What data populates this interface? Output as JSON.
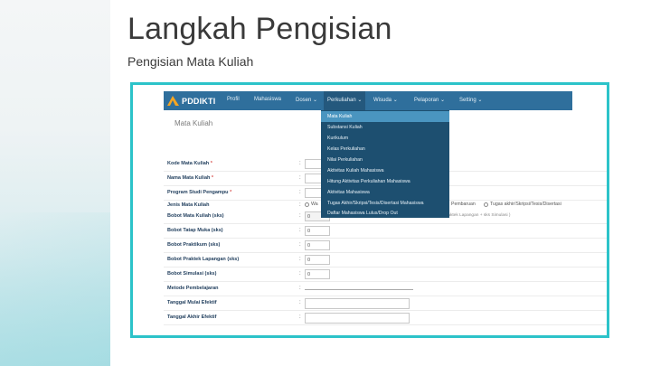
{
  "slide": {
    "title": "Langkah Pengisian",
    "subtitle": "Pengisian Mata Kuliah"
  },
  "app": {
    "brand": "PDDIKTI",
    "nav": [
      "Profil",
      "Mahasiswa",
      "Dosen",
      "Perkuliahan",
      "Wisuda",
      "Pelaporan",
      "Setting"
    ],
    "active_nav": "Perkuliahan"
  },
  "dropdown": {
    "items": [
      "Mata Kuliah",
      "Substansi Kuliah",
      "Kurikulum",
      "Kelas Perkuliahan",
      "Nilai Perkuliahan",
      "Aktivitas Kuliah Mahasiswa",
      "Hitung Aktivitas Perkuliahan Mahasiswa",
      "Aktivitas Mahasiswa",
      "Tugas Akhir/Skripsi/Tesis/Disertasi Mahasiswa",
      "Daftar Mahasiswa Lulus/Drop Out"
    ],
    "selected": "Mata Kuliah"
  },
  "form": {
    "title": "Mata Kuliah",
    "fields": {
      "kode": {
        "label": "Kode Mata Kuliah",
        "required": "*"
      },
      "nama": {
        "label": "Nama Mata Kuliah",
        "required": "*"
      },
      "prodi": {
        "label": "Program Studi Pengampu",
        "required": "*"
      },
      "jenis": {
        "label": "Jenis Mata Kuliah",
        "options_partial": [
          "Wa",
          "Pembaruan",
          "Tugas akhir/Skripsi/Tesis/Disertasi"
        ]
      },
      "bobot_mk": {
        "label": "Bobot Mata Kuliah (sks)",
        "value": "0",
        "hint": "( sks Tatap Muka + sks Praktikum + sks Praktek Lapangan + sks Simulasi )"
      },
      "bobot_tm": {
        "label": "Bobot Tatap Muka (sks)",
        "value": "0"
      },
      "bobot_prak": {
        "label": "Bobot Praktikum (sks)",
        "value": "0"
      },
      "bobot_pl": {
        "label": "Bobot Praktek Lapangan (sks)",
        "value": "0"
      },
      "bobot_sim": {
        "label": "Bobot Simulasi (sks)",
        "value": "0"
      },
      "metode": {
        "label": "Metode Pembelajaran"
      },
      "mulai": {
        "label": "Tanggal Mulai Efektif"
      },
      "akhir": {
        "label": "Tanggal Akhir Efektif"
      }
    },
    "colon": ":"
  }
}
